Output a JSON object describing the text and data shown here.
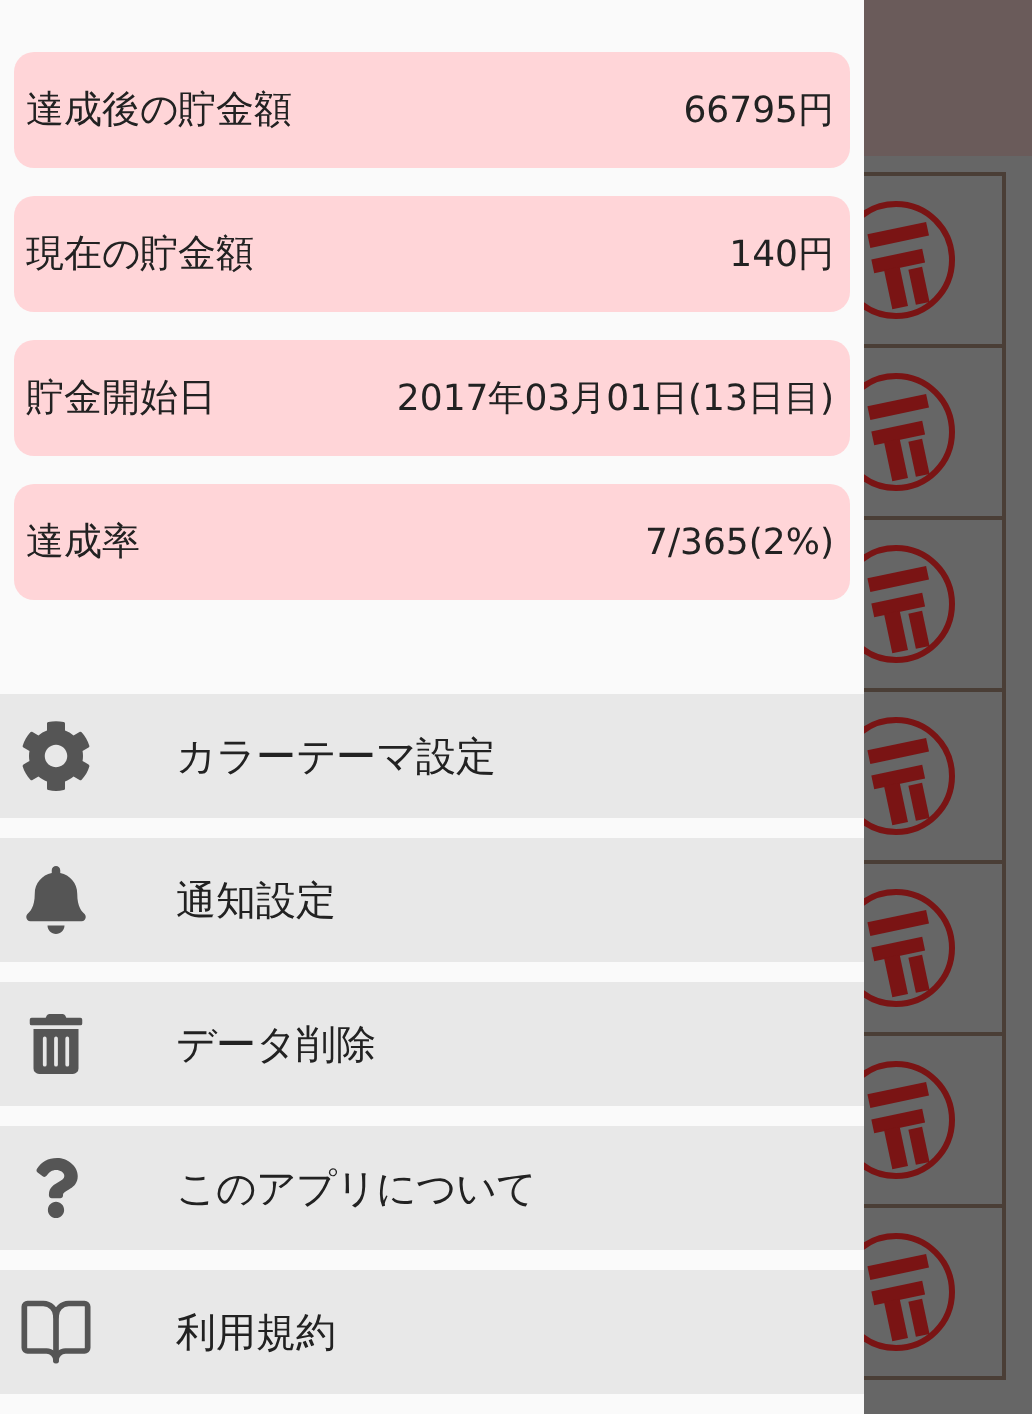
{
  "summary": [
    {
      "label": "達成後の貯金額",
      "value": "66795円"
    },
    {
      "label": "現在の貯金額",
      "value": "140円"
    },
    {
      "label": "貯金開始日",
      "value": "2017年03月01日(13日目)"
    },
    {
      "label": "達成率",
      "value": "7/365(2%)"
    }
  ],
  "menu": [
    {
      "kind": "gear",
      "label": "カラーテーマ設定"
    },
    {
      "kind": "bell",
      "label": "通知設定"
    },
    {
      "kind": "trash",
      "label": "データ削除"
    },
    {
      "kind": "question",
      "label": "このアプリについて"
    },
    {
      "kind": "book",
      "label": "利用規約"
    }
  ],
  "background": {
    "stamps": [
      {
        "stamped": true
      },
      {
        "stamped": true
      },
      {
        "stamped": true
      },
      {
        "stamped": true
      },
      {
        "stamped": true
      },
      {
        "stamped": true
      },
      {
        "stamped": true
      }
    ]
  }
}
